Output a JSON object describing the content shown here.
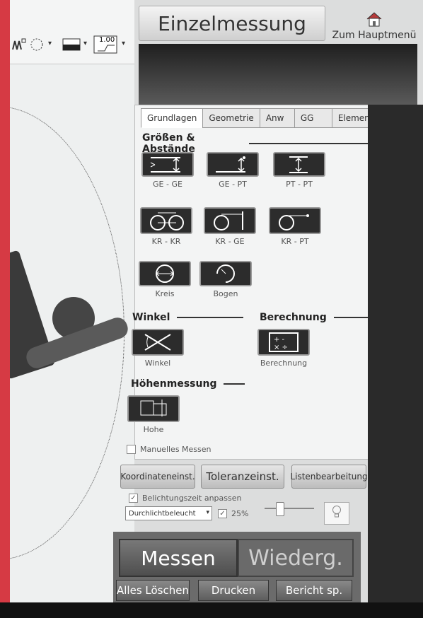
{
  "window": {
    "title": "Einzelmessung",
    "home_label": "Zum Hauptmenü"
  },
  "left_toolbar": {
    "line_value": "1.00"
  },
  "tabs": [
    {
      "label": "Grundlagen",
      "active": true
    },
    {
      "label": "Geometrie",
      "active": false
    },
    {
      "label": "Anw",
      "active": false
    },
    {
      "label": "GG",
      "active": false
    },
    {
      "label": "Element",
      "active": false
    }
  ],
  "sections": {
    "groessen": "Größen & Abstände",
    "winkel": "Winkel",
    "berechnung": "Berechnung",
    "hoehen": "Höhenmessung"
  },
  "measure_buttons": {
    "ge_ge": "GE - GE",
    "ge_pt": "GE - PT",
    "pt_pt": "PT - PT",
    "kr_kr": "KR - KR",
    "kr_ge": "KR - GE",
    "kr_pt": "KR - PT",
    "kreis": "Kreis",
    "bogen": "Bogen",
    "winkel": "Winkel",
    "berechnung": "Berechnung",
    "hohe": "Hohe"
  },
  "manual_measure": {
    "label": "Manuelles Messen",
    "checked": false
  },
  "action_buttons": {
    "koordinaten": "Koordinateneinst.",
    "toleranz": "Toleranzeinst.",
    "listen": "Listenbearbeitung"
  },
  "exposure": {
    "label": "Belichtungszeit anpassen",
    "checked": true
  },
  "lighting": {
    "selected": "Durchlichtbeleucht",
    "percent_checked": true,
    "percent": "25%"
  },
  "bottom": {
    "messen": "Messen",
    "wiederg": "Wiederg.",
    "alles_loeschen": "Alles Löschen",
    "drucken": "Drucken",
    "bericht": "Bericht sp."
  },
  "colors": {
    "accent_red": "#d63a44",
    "button_dark": "#2c2c2c",
    "panel_bg": "#f3f4f4"
  }
}
